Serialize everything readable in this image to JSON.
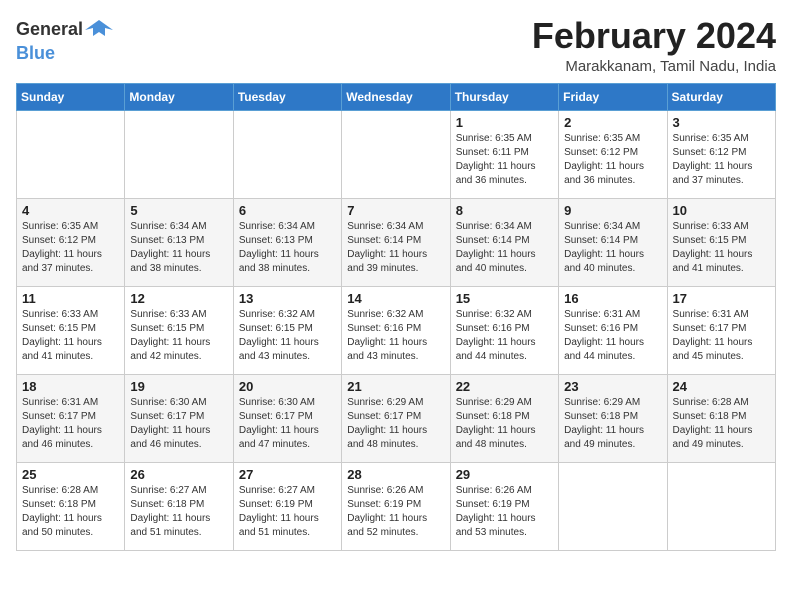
{
  "header": {
    "logo_general": "General",
    "logo_blue": "Blue",
    "title": "February 2024",
    "subtitle": "Marakkanam, Tamil Nadu, India"
  },
  "days_of_week": [
    "Sunday",
    "Monday",
    "Tuesday",
    "Wednesday",
    "Thursday",
    "Friday",
    "Saturday"
  ],
  "weeks": [
    [
      {
        "day": "",
        "info": ""
      },
      {
        "day": "",
        "info": ""
      },
      {
        "day": "",
        "info": ""
      },
      {
        "day": "",
        "info": ""
      },
      {
        "day": "1",
        "info": "Sunrise: 6:35 AM\nSunset: 6:11 PM\nDaylight: 11 hours and 36 minutes."
      },
      {
        "day": "2",
        "info": "Sunrise: 6:35 AM\nSunset: 6:12 PM\nDaylight: 11 hours and 36 minutes."
      },
      {
        "day": "3",
        "info": "Sunrise: 6:35 AM\nSunset: 6:12 PM\nDaylight: 11 hours and 37 minutes."
      }
    ],
    [
      {
        "day": "4",
        "info": "Sunrise: 6:35 AM\nSunset: 6:12 PM\nDaylight: 11 hours and 37 minutes."
      },
      {
        "day": "5",
        "info": "Sunrise: 6:34 AM\nSunset: 6:13 PM\nDaylight: 11 hours and 38 minutes."
      },
      {
        "day": "6",
        "info": "Sunrise: 6:34 AM\nSunset: 6:13 PM\nDaylight: 11 hours and 38 minutes."
      },
      {
        "day": "7",
        "info": "Sunrise: 6:34 AM\nSunset: 6:14 PM\nDaylight: 11 hours and 39 minutes."
      },
      {
        "day": "8",
        "info": "Sunrise: 6:34 AM\nSunset: 6:14 PM\nDaylight: 11 hours and 40 minutes."
      },
      {
        "day": "9",
        "info": "Sunrise: 6:34 AM\nSunset: 6:14 PM\nDaylight: 11 hours and 40 minutes."
      },
      {
        "day": "10",
        "info": "Sunrise: 6:33 AM\nSunset: 6:15 PM\nDaylight: 11 hours and 41 minutes."
      }
    ],
    [
      {
        "day": "11",
        "info": "Sunrise: 6:33 AM\nSunset: 6:15 PM\nDaylight: 11 hours and 41 minutes."
      },
      {
        "day": "12",
        "info": "Sunrise: 6:33 AM\nSunset: 6:15 PM\nDaylight: 11 hours and 42 minutes."
      },
      {
        "day": "13",
        "info": "Sunrise: 6:32 AM\nSunset: 6:15 PM\nDaylight: 11 hours and 43 minutes."
      },
      {
        "day": "14",
        "info": "Sunrise: 6:32 AM\nSunset: 6:16 PM\nDaylight: 11 hours and 43 minutes."
      },
      {
        "day": "15",
        "info": "Sunrise: 6:32 AM\nSunset: 6:16 PM\nDaylight: 11 hours and 44 minutes."
      },
      {
        "day": "16",
        "info": "Sunrise: 6:31 AM\nSunset: 6:16 PM\nDaylight: 11 hours and 44 minutes."
      },
      {
        "day": "17",
        "info": "Sunrise: 6:31 AM\nSunset: 6:17 PM\nDaylight: 11 hours and 45 minutes."
      }
    ],
    [
      {
        "day": "18",
        "info": "Sunrise: 6:31 AM\nSunset: 6:17 PM\nDaylight: 11 hours and 46 minutes."
      },
      {
        "day": "19",
        "info": "Sunrise: 6:30 AM\nSunset: 6:17 PM\nDaylight: 11 hours and 46 minutes."
      },
      {
        "day": "20",
        "info": "Sunrise: 6:30 AM\nSunset: 6:17 PM\nDaylight: 11 hours and 47 minutes."
      },
      {
        "day": "21",
        "info": "Sunrise: 6:29 AM\nSunset: 6:17 PM\nDaylight: 11 hours and 48 minutes."
      },
      {
        "day": "22",
        "info": "Sunrise: 6:29 AM\nSunset: 6:18 PM\nDaylight: 11 hours and 48 minutes."
      },
      {
        "day": "23",
        "info": "Sunrise: 6:29 AM\nSunset: 6:18 PM\nDaylight: 11 hours and 49 minutes."
      },
      {
        "day": "24",
        "info": "Sunrise: 6:28 AM\nSunset: 6:18 PM\nDaylight: 11 hours and 49 minutes."
      }
    ],
    [
      {
        "day": "25",
        "info": "Sunrise: 6:28 AM\nSunset: 6:18 PM\nDaylight: 11 hours and 50 minutes."
      },
      {
        "day": "26",
        "info": "Sunrise: 6:27 AM\nSunset: 6:18 PM\nDaylight: 11 hours and 51 minutes."
      },
      {
        "day": "27",
        "info": "Sunrise: 6:27 AM\nSunset: 6:19 PM\nDaylight: 11 hours and 51 minutes."
      },
      {
        "day": "28",
        "info": "Sunrise: 6:26 AM\nSunset: 6:19 PM\nDaylight: 11 hours and 52 minutes."
      },
      {
        "day": "29",
        "info": "Sunrise: 6:26 AM\nSunset: 6:19 PM\nDaylight: 11 hours and 53 minutes."
      },
      {
        "day": "",
        "info": ""
      },
      {
        "day": "",
        "info": ""
      }
    ]
  ]
}
